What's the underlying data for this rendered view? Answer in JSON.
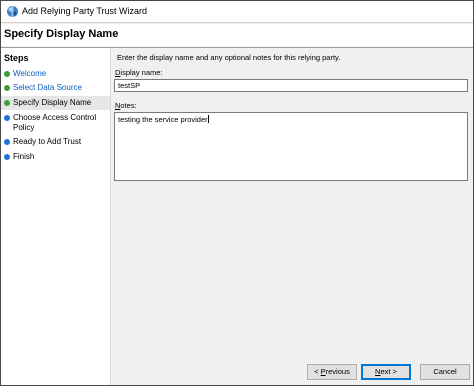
{
  "window": {
    "title": "Add Relying Party Trust Wizard"
  },
  "header": {
    "page_title": "Specify Display Name"
  },
  "steps": {
    "title": "Steps",
    "items": [
      {
        "label": "Welcome",
        "state": "done",
        "dot_color": "#3aa13a"
      },
      {
        "label": "Select Data Source",
        "state": "done",
        "dot_color": "#3aa13a"
      },
      {
        "label": "Specify Display Name",
        "state": "current",
        "dot_color": "#3aa13a"
      },
      {
        "label": "Choose Access Control Policy",
        "state": "pending",
        "dot_color": "#1e74d2"
      },
      {
        "label": "Ready to Add Trust",
        "state": "pending",
        "dot_color": "#1e74d2"
      },
      {
        "label": "Finish",
        "state": "pending",
        "dot_color": "#1e74d2"
      }
    ]
  },
  "main": {
    "instruction": "Enter the display name and any optional notes for this relying party.",
    "display_name_label_prefix": "D",
    "display_name_label_rest": "isplay name:",
    "display_name_value": "testSP",
    "notes_label_prefix": "N",
    "notes_label_rest": "otes:",
    "notes_value": "testing the service provider"
  },
  "footer": {
    "previous_prefix": "< ",
    "previous_underline": "P",
    "previous_rest": "revious",
    "next_underline": "N",
    "next_rest": "ext >",
    "cancel_label": "Cancel"
  },
  "colors": {
    "link": "#0b5fc5",
    "done": "#3aa13a",
    "pending": "#1e74d2",
    "accent": "#0078d7"
  }
}
